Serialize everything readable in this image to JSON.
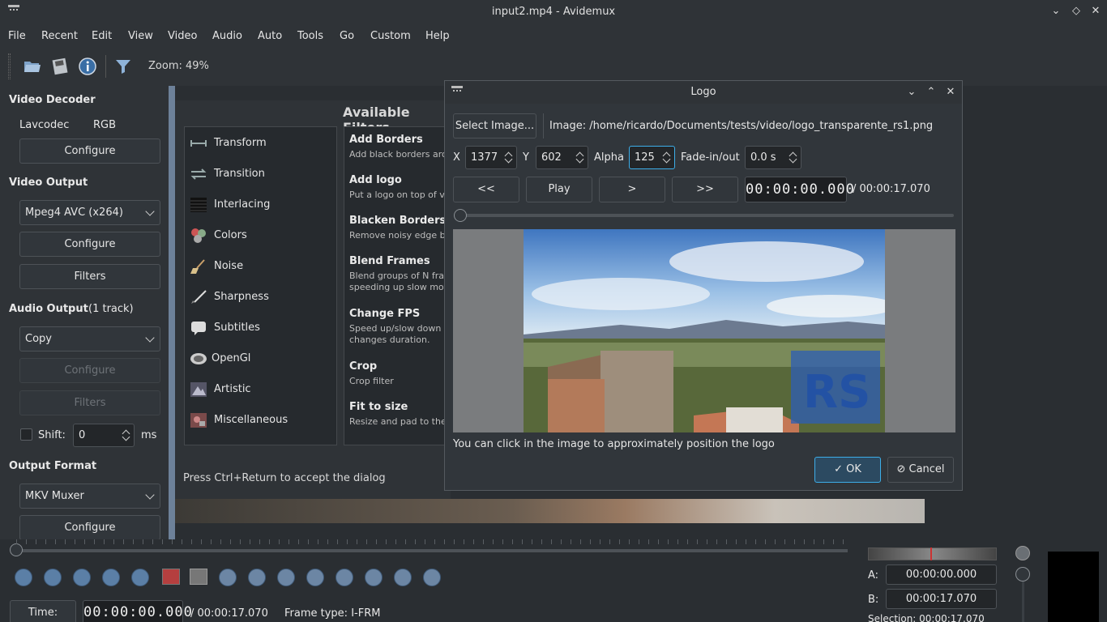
{
  "window": {
    "title": "input2.mp4 - Avidemux"
  },
  "menu": [
    "File",
    "Recent",
    "Edit",
    "View",
    "Video",
    "Audio",
    "Auto",
    "Tools",
    "Go",
    "Custom",
    "Help"
  ],
  "toolbar": {
    "zoom": "Zoom: 49%"
  },
  "left": {
    "video_decoder": "Video Decoder",
    "decoder_name": "Lavcodec",
    "decoder_fmt": "RGB",
    "configure": "Configure",
    "video_output": "Video Output",
    "video_codec": "Mpeg4 AVC (x264)",
    "filters": "Filters",
    "audio_output": "Audio Output",
    "audio_tracks": "(1 track)",
    "audio_codec": "Copy",
    "shift_label": "Shift:",
    "shift_value": "0",
    "shift_unit": "ms",
    "output_format": "Output Format",
    "muxer": "MKV Muxer"
  },
  "filters_window": {
    "heading": "Available Filters",
    "hint": "Press Ctrl+Return to accept the dialog",
    "categories": [
      "Transform",
      "Transition",
      "Interlacing",
      "Colors",
      "Noise",
      "Sharpness",
      "Subtitles",
      "OpenGl",
      "Artistic",
      "Miscellaneous"
    ],
    "items": [
      {
        "title": "Add Borders",
        "desc": "Add black borders arou"
      },
      {
        "title": "Add logo",
        "desc": "Put a logo on top of vic"
      },
      {
        "title": "Blacken Borders",
        "desc": "Remove noisy edge by"
      },
      {
        "title": "Blend Frames",
        "desc": "Blend groups of N fram",
        "desc2": "speeding up slow moti"
      },
      {
        "title": "Change FPS",
        "desc": "Speed up/slow down th",
        "desc2": "changes duration."
      },
      {
        "title": "Crop",
        "desc": "Crop filter"
      },
      {
        "title": "Fit to size",
        "desc": "Resize and pad to the s"
      }
    ]
  },
  "logo_dialog": {
    "title": "Logo",
    "select_image": "Select Image...",
    "image_path": "Image: /home/ricardo/Documents/tests/video/logo_transparente_rs1.png",
    "x_label": "X",
    "x_value": "1377",
    "y_label": "Y",
    "y_value": "602",
    "alpha_label": "Alpha",
    "alpha_value": "125",
    "fade_label": "Fade-in/out",
    "fade_value": "0.0 s",
    "nav": [
      "<<",
      "Play",
      ">",
      ">>"
    ],
    "time": "00:00:00.000",
    "duration": "/ 00:00:17.070",
    "hint": "You can click in the image to approximately position the logo",
    "ok": "OK",
    "cancel": "Cancel"
  },
  "bottom": {
    "time_button": "Time:",
    "current_time": "00:00:00.000",
    "total_time": "/ 00:00:17.070",
    "frame_type": "Frame type:  I-FRM",
    "a_label": "A:",
    "a_value": "00:00:00.000",
    "b_label": "B:",
    "b_value": "00:00:17.070",
    "selection": "Selection: 00:00:17.070"
  }
}
